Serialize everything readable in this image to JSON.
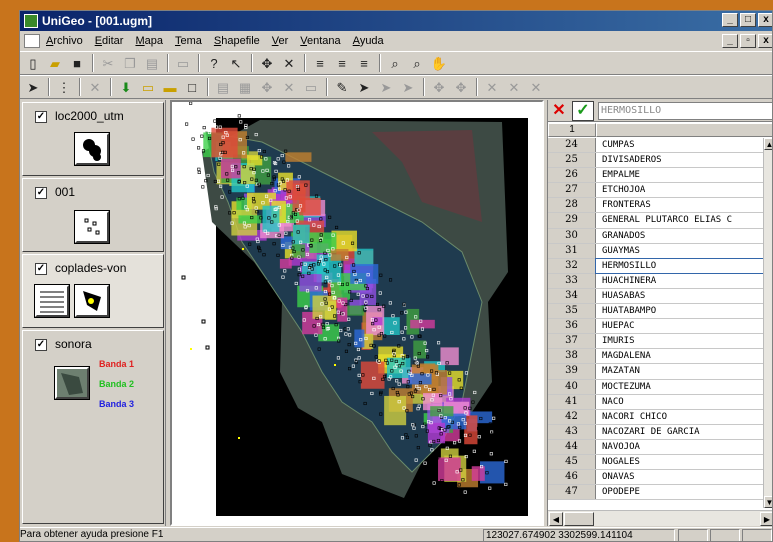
{
  "window": {
    "title": "UniGeo - [001.ugm]"
  },
  "menu": {
    "items": [
      "Archivo",
      "Editar",
      "Mapa",
      "Tema",
      "Shapefile",
      "Ver",
      "Ventana",
      "Ayuda"
    ]
  },
  "toolbar1": {
    "icons": [
      "new-icon",
      "open-icon",
      "save-icon",
      "cut-icon",
      "copy-icon",
      "paste-icon",
      "print-icon",
      "help-icon",
      "context-help-icon",
      "add-icon",
      "delete-icon",
      "layer-icon",
      "layer-add-icon",
      "layer-remove-icon",
      "zoom-in-icon",
      "zoom-out-icon",
      "pan-icon"
    ]
  },
  "toolbar2": {
    "icons": [
      "select-icon",
      "node-icon",
      "x-icon",
      "import-icon",
      "rect-icon",
      "rect-fill-icon",
      "rect-empty-icon",
      "table-icon",
      "form-icon",
      "plus-icon",
      "x2-icon",
      "field-icon",
      "pencil-icon",
      "arrow-icon",
      "arrow2-icon",
      "arrow3-icon",
      "plus2-icon",
      "plus3-icon",
      "x3-icon",
      "x4-icon",
      "x5-icon"
    ]
  },
  "layers": [
    {
      "name": "loc2000_utm",
      "checked": "✓"
    },
    {
      "name": "001",
      "checked": "✓"
    },
    {
      "name": "coplades-von",
      "checked": "✓"
    },
    {
      "name": "sonora",
      "checked": "✓",
      "bands": [
        "Banda 1",
        "Banda 2",
        "Banda 3"
      ],
      "band_colors": [
        "#e02020",
        "#20c020",
        "#2020e0"
      ]
    }
  ],
  "table": {
    "current_value": "HERMOSILLO",
    "header_row": "1",
    "rows": [
      {
        "n": "24",
        "name": "CUMPAS"
      },
      {
        "n": "25",
        "name": "DIVISADEROS"
      },
      {
        "n": "26",
        "name": "EMPALME"
      },
      {
        "n": "27",
        "name": "ETCHOJOA"
      },
      {
        "n": "28",
        "name": "FRONTERAS"
      },
      {
        "n": "29",
        "name": "GENERAL PLUTARCO ELIAS C"
      },
      {
        "n": "30",
        "name": "GRANADOS"
      },
      {
        "n": "31",
        "name": "GUAYMAS"
      },
      {
        "n": "32",
        "name": "HERMOSILLO"
      },
      {
        "n": "33",
        "name": "HUACHINERA"
      },
      {
        "n": "34",
        "name": "HUASABAS"
      },
      {
        "n": "35",
        "name": "HUATABAMPO"
      },
      {
        "n": "36",
        "name": "HUEPAC"
      },
      {
        "n": "37",
        "name": "IMURIS"
      },
      {
        "n": "38",
        "name": "MAGDALENA"
      },
      {
        "n": "39",
        "name": "MAZATAN"
      },
      {
        "n": "40",
        "name": "MOCTEZUMA"
      },
      {
        "n": "41",
        "name": "NACO"
      },
      {
        "n": "42",
        "name": "NACORI CHICO"
      },
      {
        "n": "43",
        "name": "NACOZARI DE GARCIA"
      },
      {
        "n": "44",
        "name": "NAVOJOA"
      },
      {
        "n": "45",
        "name": "NOGALES"
      },
      {
        "n": "46",
        "name": "ONAVAS"
      },
      {
        "n": "47",
        "name": "OPODEPE"
      }
    ],
    "selected": "32"
  },
  "status": {
    "help": "Para obtener ayuda presione F1",
    "coords": "123027.674902 3302599.141104"
  }
}
